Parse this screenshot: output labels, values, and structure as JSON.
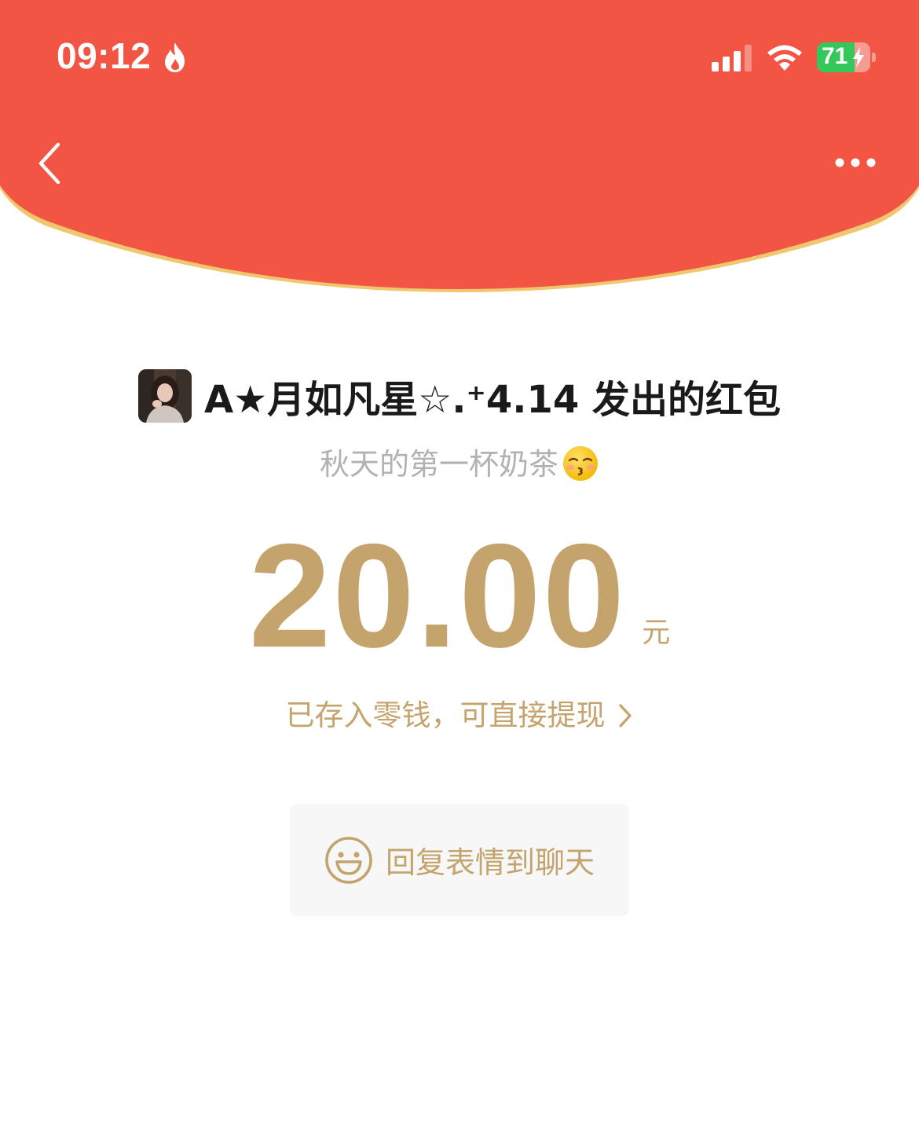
{
  "status_bar": {
    "time": "09:12",
    "battery_percent": "71",
    "battery_level": 0.71,
    "flame_icon": "flame-icon",
    "signal_icon": "cellular-signal-icon",
    "wifi_icon": "wifi-icon",
    "charging_icon": "bolt-icon"
  },
  "nav": {
    "back_icon": "chevron-left-icon",
    "more_icon": "more-dots-icon"
  },
  "red_packet": {
    "sender_title": "A★月如凡星☆.⁺4.14 发出的红包",
    "greeting": "秋天的第一杯奶茶",
    "greeting_emoji": "kissing-face-emoji",
    "amount": "20.00",
    "unit": "元",
    "wallet_notice": "已存入零钱，可直接提现"
  },
  "reply": {
    "label": "回复表情到聊天",
    "icon": "smile-icon"
  },
  "colors": {
    "header_red": "#F25543",
    "gold": "#C4A46C",
    "header_rim": "#F0C76E",
    "button_bg": "#F7F7F7"
  }
}
